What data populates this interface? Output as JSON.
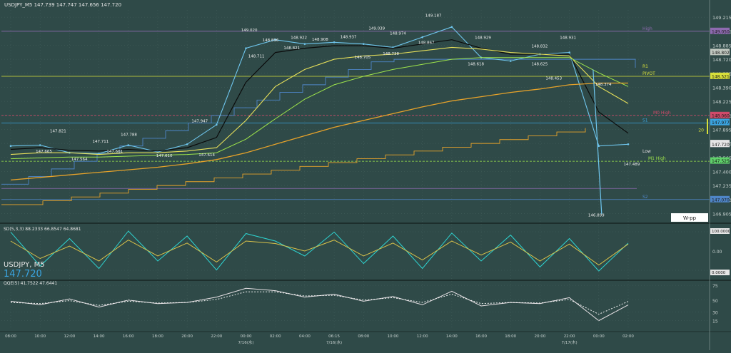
{
  "window": {
    "title": "USDJPY_M5 147.739 147.747 147.656 147.720"
  },
  "colors": {
    "background": "#2f4a48",
    "grid": "#46625f",
    "axis_text": "#c8d2d0",
    "price_line": "#6fc6ee",
    "ma_black": "#0b0b0b",
    "ma_yellow": "#e7e05a",
    "ma_green": "#9ee54b",
    "ma_blue": "#4f86c8",
    "ma_orange": "#e6a22a",
    "stoch_cyan": "#2ed3d0",
    "stoch_yellow": "#d9c24a",
    "stoch_mauve": "#b0889a",
    "qqe_white": "#e8e2e6",
    "pivot_yellow": "#d8e03a",
    "high_purple": "#8e6ab0",
    "r1_red": "#d04a6a",
    "s1_blue": "#3aa4e0"
  },
  "price_axis": {
    "labels": [
      "149.215",
      "149.050",
      "148.885",
      "148.720",
      "148.555",
      "148.390",
      "148.225",
      "148.060",
      "147.895",
      "147.730",
      "147.565",
      "147.400",
      "147.235",
      "147.070",
      "146.905"
    ],
    "badges": [
      "149.050",
      "148.802",
      "148.521",
      "148.060",
      "147.977",
      "147.730",
      "147.720",
      "147.525",
      "147.070"
    ]
  },
  "levels": {
    "high": "High",
    "pivot": "PIVOT",
    "r1": "R1",
    "s1": "S1",
    "s2": "S2",
    "low": "Low",
    "m1_high": "M1 High",
    "mid_high": "M0 High",
    "vpp": "W-pp",
    "side_value": "20"
  },
  "price_annotations": [
    {
      "text": "147.821"
    },
    {
      "text": "147.788"
    },
    {
      "text": "147.711"
    },
    {
      "text": "147.665"
    },
    {
      "text": "147.564"
    },
    {
      "text": "147.661"
    },
    {
      "text": "147.610"
    },
    {
      "text": "147.947"
    },
    {
      "text": "147.614"
    },
    {
      "text": "149.020"
    },
    {
      "text": "148.896"
    },
    {
      "text": "148.711"
    },
    {
      "text": "148.922"
    },
    {
      "text": "148.821"
    },
    {
      "text": "148.908"
    },
    {
      "text": "148.937"
    },
    {
      "text": "149.039"
    },
    {
      "text": "148.974"
    },
    {
      "text": "148.705"
    },
    {
      "text": "148.738"
    },
    {
      "text": "148.867"
    },
    {
      "text": "149.187"
    },
    {
      "text": "148.929"
    },
    {
      "text": "148.618"
    },
    {
      "text": "148.832"
    },
    {
      "text": "148.625"
    },
    {
      "text": "148.931"
    },
    {
      "text": "148.453"
    },
    {
      "text": "148.374"
    },
    {
      "text": "147.489"
    },
    {
      "text": "146.899"
    }
  ],
  "stoch_panel": {
    "label": "SD(5,3,3) 88.2333 66.8547 64.8681",
    "symbol": "USDJPY, M5",
    "price": "147.720",
    "axis": [
      "100.0000",
      "0.00",
      "0.0000"
    ]
  },
  "qqe_panel": {
    "label": "QQE(5) 41.7522 47.6441",
    "axis": [
      "75",
      "50",
      "30",
      "15"
    ]
  },
  "time_axis": {
    "labels": [
      "08:00",
      "10:00",
      "12:00",
      "14:00",
      "16:00",
      "18:00",
      "20:00",
      "22:00",
      "00:00",
      "02:00",
      "04:00",
      "06:15",
      "08:00",
      "10:00",
      "12:00",
      "14:00",
      "16:00",
      "18:00",
      "20:00",
      "22:00",
      "00:00",
      "02:00"
    ],
    "date_labels": [
      "7/16(水)",
      "7/16(水)",
      "7/17(木)"
    ]
  },
  "chart_data": {
    "type": "line",
    "title": "USDJPY_M5 147.739 147.747 147.656 147.720",
    "xlabel": "",
    "ylabel": "",
    "ylim": [
      146.85,
      149.3
    ],
    "grid": true,
    "x": [
      "08:00",
      "10:00",
      "12:00",
      "14:00",
      "16:00",
      "18:00",
      "20:00",
      "22:00",
      "00:00",
      "02:00",
      "04:00",
      "06:15",
      "08:00",
      "10:00",
      "12:00",
      "14:00",
      "16:00",
      "18:00",
      "20:00",
      "22:00",
      "00:00",
      "02:00"
    ],
    "series": [
      {
        "values": [
          147.7,
          147.71,
          147.62,
          147.61,
          147.71,
          147.63,
          147.72,
          147.95,
          148.85,
          148.95,
          148.9,
          148.92,
          148.9,
          148.86,
          148.98,
          149.1,
          148.74,
          148.7,
          148.78,
          148.8,
          147.7,
          147.72
        ]
      },
      {
        "values": [
          147.66,
          147.68,
          147.65,
          147.64,
          147.66,
          147.64,
          147.68,
          147.8,
          148.45,
          148.8,
          148.85,
          148.88,
          148.88,
          148.85,
          148.9,
          148.95,
          148.85,
          148.78,
          148.78,
          148.78,
          148.1,
          147.85
        ]
      },
      {
        "values": [
          147.6,
          147.62,
          147.62,
          147.6,
          147.62,
          147.62,
          147.64,
          147.68,
          148.0,
          148.4,
          148.6,
          148.72,
          148.76,
          148.78,
          148.82,
          148.86,
          148.84,
          148.8,
          148.78,
          148.76,
          148.4,
          148.2
        ]
      },
      {
        "values": [
          147.55,
          147.56,
          147.57,
          147.57,
          147.58,
          147.59,
          147.6,
          147.62,
          147.78,
          148.02,
          148.25,
          148.42,
          148.52,
          148.6,
          148.66,
          148.72,
          148.74,
          148.74,
          148.74,
          148.74,
          148.56,
          148.4
        ]
      },
      {
        "values": [
          147.3,
          147.33,
          147.36,
          147.39,
          147.42,
          147.45,
          147.49,
          147.54,
          147.62,
          147.72,
          147.82,
          147.92,
          148.0,
          148.08,
          148.16,
          148.23,
          148.28,
          148.33,
          148.37,
          148.42,
          148.44,
          148.44
        ]
      }
    ],
    "subcharts": [
      {
        "type": "line",
        "name": "SD(5,3,3)",
        "ylim": [
          0,
          100
        ],
        "series": [
          {
            "values": [
              88,
              20,
              75,
              15,
              90,
              30,
              80,
              12,
              85,
              70,
              40,
              88,
              25,
              80,
              15,
              86,
              30,
              82,
              18,
              75,
              10,
              66
            ]
          },
          {
            "values": [
              70,
              35,
              60,
              30,
              72,
              40,
              66,
              28,
              70,
              65,
              50,
              72,
              40,
              66,
              32,
              70,
              42,
              68,
              30,
              64,
              22,
              64
            ]
          }
        ]
      },
      {
        "type": "line",
        "name": "QQE(5)",
        "ylim": [
          0,
          80
        ],
        "series": [
          {
            "values": [
              48,
              42,
              52,
              38,
              50,
              44,
              46,
              55,
              70,
              66,
              55,
              60,
              48,
              56,
              42,
              65,
              40,
              46,
              44,
              54,
              15,
              41.75
            ]
          },
          {
            "values": [
              46,
              44,
              49,
              41,
              48,
              45,
              46,
              51,
              64,
              64,
              57,
              58,
              50,
              54,
              46,
              60,
              44,
              46,
              45,
              51,
              26,
              47.64
            ]
          }
        ]
      }
    ]
  }
}
